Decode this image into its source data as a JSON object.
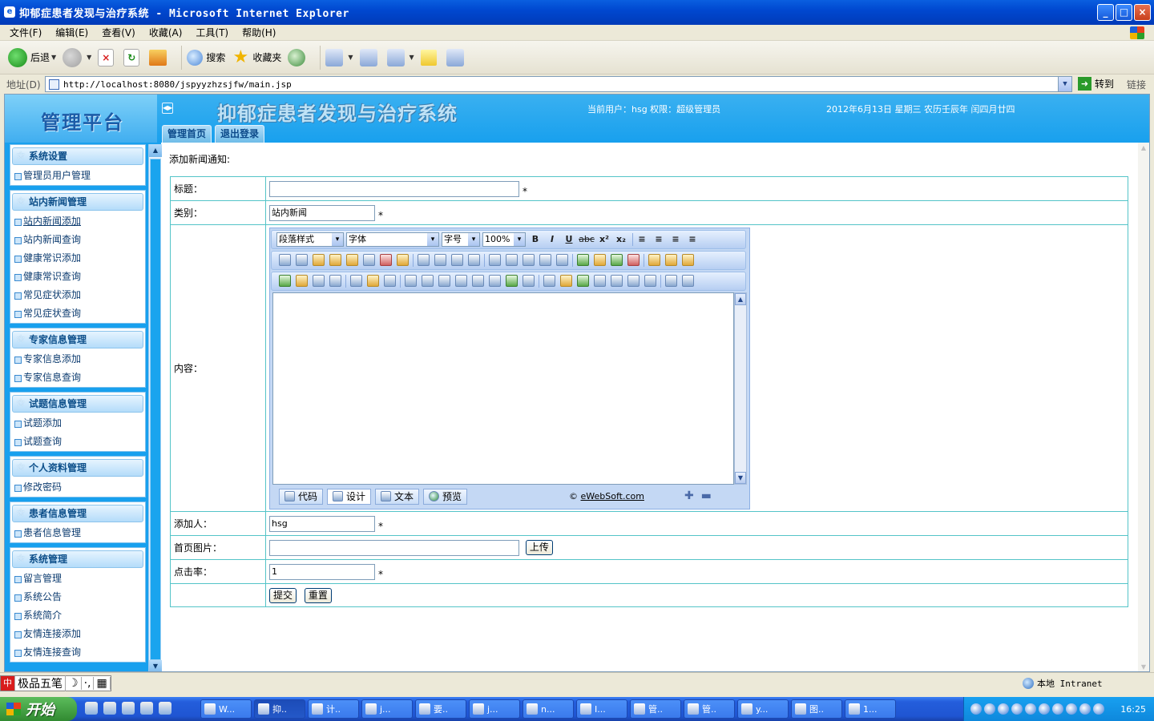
{
  "window": {
    "title": "抑郁症患者发现与治疗系统 - Microsoft Internet Explorer",
    "buttons": [
      "_",
      "□",
      "×"
    ]
  },
  "menubar": [
    "文件(F)",
    "编辑(E)",
    "查看(V)",
    "收藏(A)",
    "工具(T)",
    "帮助(H)"
  ],
  "toolbar": {
    "back_label": "后退",
    "search_label": "搜索",
    "favorites_label": "收藏夹"
  },
  "address": {
    "label": "地址(D)",
    "url": "http://localhost:8080/jspyyzhzsjfw/main.jsp",
    "go_label": "转到",
    "links_label": "链接"
  },
  "header": {
    "brand": "管理平台",
    "system_title": "抑郁症患者发现与治疗系统",
    "current_user": "当前用户：hsg 权限：超级管理员",
    "date": "2012年6月13日 星期三 农历壬辰年 闰四月廿四",
    "tabs": [
      "管理首页",
      "退出登录"
    ]
  },
  "sidebar": {
    "groups": [
      {
        "title": "系统设置",
        "items": [
          "管理员用户管理"
        ]
      },
      {
        "title": "站内新闻管理",
        "items": [
          "站内新闻添加",
          "站内新闻查询",
          "健康常识添加",
          "健康常识查询",
          "常见症状添加",
          "常见症状查询"
        ]
      },
      {
        "title": "专家信息管理",
        "items": [
          "专家信息添加",
          "专家信息查询"
        ]
      },
      {
        "title": "试题信息管理",
        "items": [
          "试题添加",
          "试题查询"
        ]
      },
      {
        "title": "个人资料管理",
        "items": [
          "修改密码"
        ]
      },
      {
        "title": "患者信息管理",
        "items": [
          "患者信息管理"
        ]
      },
      {
        "title": "系统管理",
        "items": [
          "留言管理",
          "系统公告",
          "系统简介",
          "友情连接添加",
          "友情连接查询"
        ]
      }
    ]
  },
  "form": {
    "heading": "添加新闻通知:",
    "title_label": "标题：",
    "title_value": "",
    "category_label": "类别：",
    "category_value": "站内新闻",
    "content_label": "内容：",
    "author_label": "添加人：",
    "author_value": "hsg",
    "image_label": "首页图片：",
    "image_value": "",
    "upload_button": "上传",
    "clicks_label": "点击率：",
    "clicks_value": "1",
    "required_mark": "*",
    "submit_button": "提交",
    "reset_button": "重置"
  },
  "editor": {
    "paragraph_style": "段落样式",
    "font": "字体",
    "font_size": "字号",
    "zoom": "100%",
    "format_buttons": [
      "B",
      "I",
      "U",
      "abc",
      "x²",
      "x₂"
    ],
    "modes": [
      "代码",
      "设计",
      "文本",
      "预览"
    ],
    "copyright_symbol": "©",
    "copyright_link": "eWebSoft.com"
  },
  "statusbar": {
    "ime": [
      "极品五笔"
    ],
    "zone": "本地 Intranet"
  },
  "taskbar": {
    "start": "开始",
    "tasks": [
      "W...",
      "抑..",
      "计..",
      "j...",
      "要..",
      "j...",
      "n...",
      "I...",
      "管..",
      "管..",
      "y...",
      "图..",
      "1..."
    ],
    "clock": "16:25"
  }
}
